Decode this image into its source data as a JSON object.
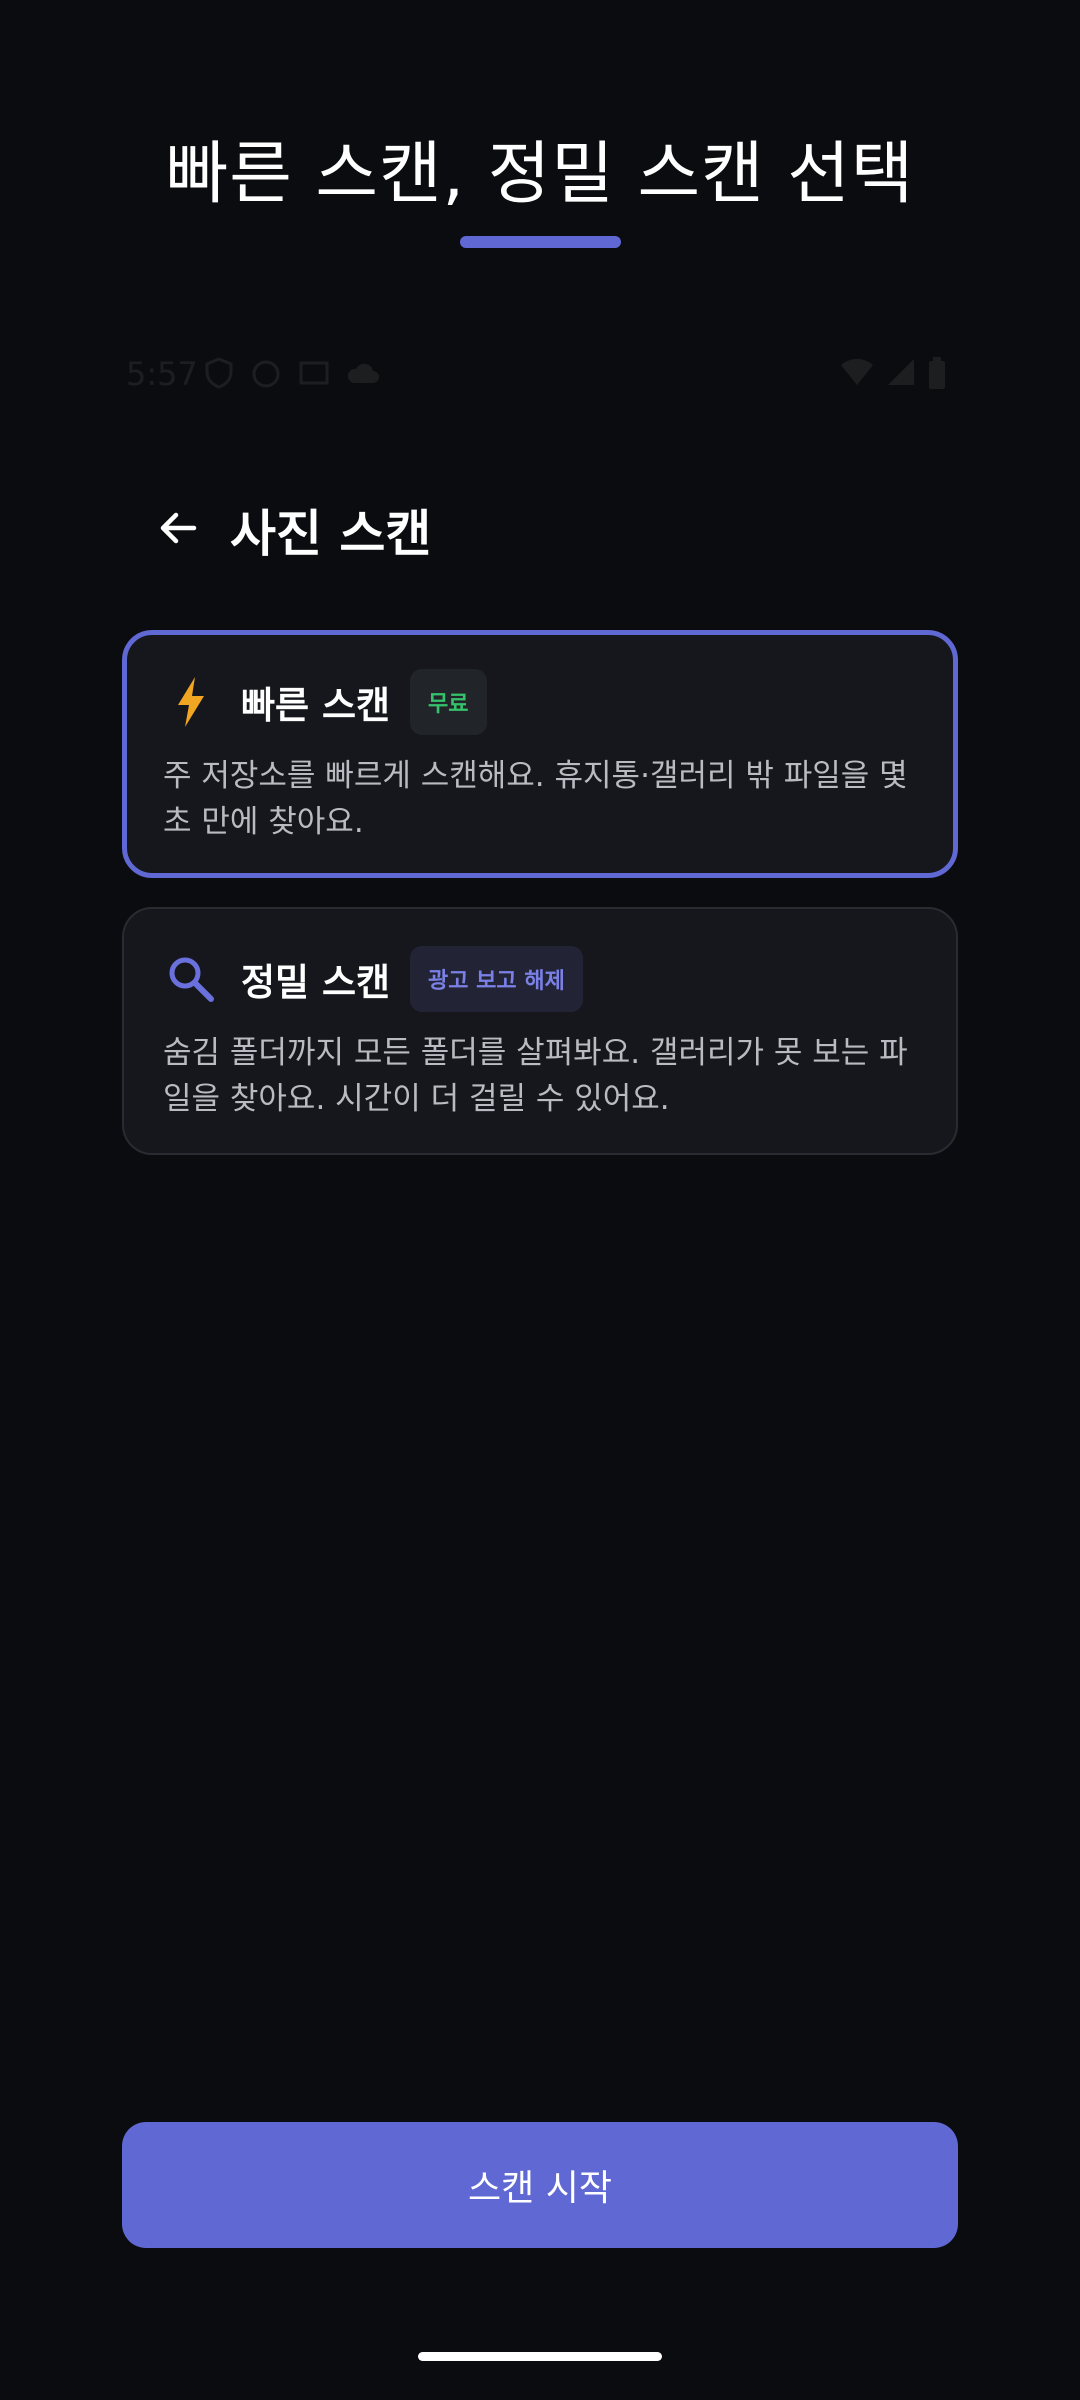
{
  "promo": {
    "title": "빠른 스캔, 정밀 스캔 선택"
  },
  "status_bar": {
    "time": "5:57",
    "left_icons": [
      "shield-icon",
      "cat-icon",
      "window-icon",
      "cloud-icon"
    ],
    "right_icons": [
      "wifi-icon",
      "signal-icon",
      "battery-icon"
    ]
  },
  "header": {
    "back_icon": "arrow-left-icon",
    "title": "사진 스캔"
  },
  "options": [
    {
      "id": "fast",
      "icon": "lightning-icon",
      "title": "빠른 스캔",
      "badge": "무료",
      "description": "주 저장소를 빠르게 스캔해요. 휴지통·갤러리 밖 파일을 몇 초 만에 찾아요.",
      "selected": true
    },
    {
      "id": "deep",
      "icon": "search-icon",
      "title": "정밀 스캔",
      "badge": "광고 보고 해제",
      "description": "숨김 폴더까지 모든 폴더를 살펴봐요. 갤러리가 못 보는 파일을 찾아요. 시간이 더 걸릴 수 있어요.",
      "selected": false
    }
  ],
  "start_button": {
    "label": "스캔 시작"
  },
  "colors": {
    "background": "#0b0c0f",
    "accent": "#6068d3",
    "card": "#16171c",
    "free_badge_text": "#35c26b",
    "ad_badge_text": "#7a80e6",
    "lightning": "#f0a623",
    "search_icon": "#6a70dc"
  }
}
